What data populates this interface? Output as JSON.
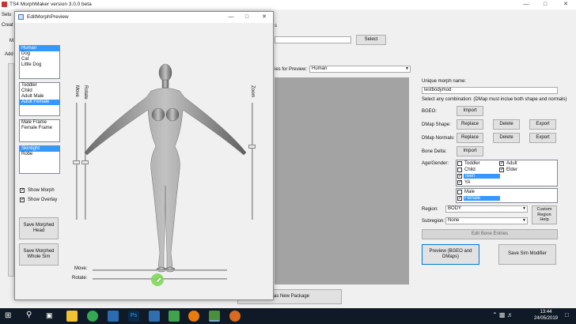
{
  "main": {
    "title": "TS4 MorphMaker version 3.0.0 beta",
    "menu_fragment": "Setu",
    "tab_fragment_1": "Creat",
    "tab_fragment_2": "Add",
    "left_btn_fragment": "M",
    "select_label": "Select",
    "frag_near_select": "s",
    "species_label": "ies for Preview:",
    "species_value": "Human",
    "unique_name_label": "Unique morph name:",
    "unique_name_value": "testbodymod",
    "combination_label": "Select any combination: (DMap must inclue both shape and normals)",
    "bgeo_label": "BGEO:",
    "import_label": "Import",
    "dmap_shape_label": "DMap Shape:",
    "dmap_normals_label": "DMap Normals:",
    "replace_label": "Replace",
    "delete_label": "Delete",
    "export_label": "Export",
    "bone_delta_label": "Bone Delta:",
    "age_gender_label": "Age/Gender:",
    "ages": [
      {
        "label": "Toddler",
        "checked": false
      },
      {
        "label": "Child",
        "checked": false
      },
      {
        "label": "Teen",
        "checked": true,
        "selected": true
      },
      {
        "label": "YA",
        "checked": true
      }
    ],
    "ages2": [
      {
        "label": "Adult",
        "checked": true
      },
      {
        "label": "Elder",
        "checked": true
      }
    ],
    "genders": [
      {
        "label": "Male",
        "checked": false
      },
      {
        "label": "Female",
        "checked": true,
        "selected": true
      }
    ],
    "region_label": "Region:",
    "region_value": "BODY",
    "subregion_label": "Subregion:",
    "subregion_value": "None",
    "custom_region_label": "Custom Region Help",
    "edit_bone_label": "Edit Bone Entries",
    "preview_btn_label": "Preview (BGEO and DMaps)",
    "save_sim_label": "Save Sim Modifier",
    "save_package_label": "e as New Package"
  },
  "preview": {
    "title": "EditMorphPreview",
    "species_list": [
      "Human",
      "Dog",
      "Cat",
      "Little Dog"
    ],
    "species_selected": "Human",
    "age_list": [
      "Toddler",
      "Child",
      "Adult Male",
      "Adult Female"
    ],
    "age_selected": "Adult Female",
    "frame_list": [
      "Male Frame",
      "Female Frame"
    ],
    "outfit_list": [
      "Skintight",
      "Robe"
    ],
    "outfit_selected": "Skintight",
    "move_label": "Move",
    "rotate_label": "Rotate",
    "zoom_label": "Zoom",
    "show_morph_label": "Show Morph",
    "show_overlay_label": "Show Overlay",
    "show_morph_checked": true,
    "show_overlay_checked": true,
    "save_head_label": "Save Morphed Head",
    "save_whole_label": "Save Morphed Whole Sim",
    "move_h_label": "Move:",
    "rotate_h_label": "Rotate:"
  },
  "taskbar": {
    "time": "13:44",
    "date": "24/05/2019"
  },
  "colors": {
    "selection": "#3399ff",
    "viewport_gray": "#a3a3a3",
    "taskbar": "#0f1a26",
    "cursor_highlight": "#7ed957"
  }
}
